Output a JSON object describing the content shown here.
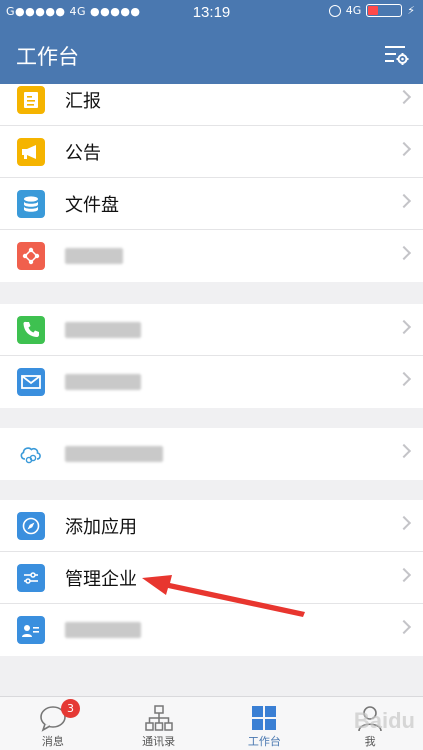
{
  "status": {
    "carrier": "G●●●●● 4G ●●●●●",
    "time": "13:19",
    "network": "4G"
  },
  "header": {
    "title": "工作台"
  },
  "groups": [
    {
      "items": [
        {
          "label": "汇报",
          "icon": "report-icon",
          "color": "#f5b400"
        },
        {
          "label": "公告",
          "icon": "megaphone-icon",
          "color": "#f5b400"
        },
        {
          "label": "文件盘",
          "icon": "database-icon",
          "color": "#3a9ad9"
        },
        {
          "label": "",
          "icon": "share-nodes-icon",
          "color": "#f0604d"
        }
      ]
    },
    {
      "items": [
        {
          "label": "",
          "icon": "phone-icon",
          "color": "#3ec150"
        },
        {
          "label": "",
          "icon": "mail-icon",
          "color": "#3a8fde"
        }
      ]
    },
    {
      "items": [
        {
          "label": "",
          "icon": "cloud-link-icon",
          "color": "#ffffff"
        }
      ]
    },
    {
      "items": [
        {
          "label": "添加应用",
          "icon": "compass-icon",
          "color": "#3a8fde"
        },
        {
          "label": "管理企业",
          "icon": "sliders-icon",
          "color": "#3a8fde"
        },
        {
          "label": "",
          "icon": "contact-card-icon",
          "color": "#3a8fde"
        }
      ]
    }
  ],
  "tabs": [
    {
      "label": "消息",
      "icon": "chat-bubble-icon",
      "badge": "3"
    },
    {
      "label": "通讯录",
      "icon": "org-chart-icon"
    },
    {
      "label": "工作台",
      "icon": "grid-icon",
      "active": true
    },
    {
      "label": "我",
      "icon": "person-icon"
    }
  ],
  "colors": {
    "brand": "#4a78b0",
    "annotation": "#e8362f"
  },
  "watermark": "Baidu"
}
